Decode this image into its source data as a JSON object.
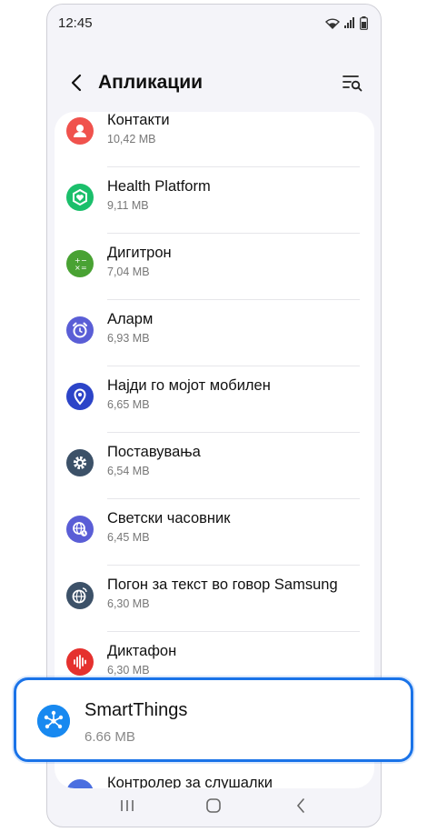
{
  "status": {
    "time": "12:45"
  },
  "header": {
    "title": "Апликации"
  },
  "apps": [
    {
      "name": "Контакти",
      "size": "10,42 MB",
      "icon": "contacts-icon",
      "color": "#f0524d"
    },
    {
      "name": "Health Platform",
      "size": "9,11 MB",
      "icon": "health-platform-icon",
      "color": "#1bbf6b"
    },
    {
      "name": "Дигитрон",
      "size": "7,04 MB",
      "icon": "calculator-icon",
      "color": "#49a233"
    },
    {
      "name": "Аларм",
      "size": "6,93 MB",
      "icon": "alarm-icon",
      "color": "#5a5ed6"
    },
    {
      "name": "Најди го мојот мобилен",
      "size": "6,65 MB",
      "icon": "find-my-mobile-icon",
      "color": "#2c44c8"
    },
    {
      "name": "Поставувања",
      "size": "6,54 MB",
      "icon": "settings-gear-icon",
      "color": "#3c5168"
    },
    {
      "name": "Светски часовник",
      "size": "6,45 MB",
      "icon": "world-clock-icon",
      "color": "#5a5ed6"
    },
    {
      "name": "Погон за текст во говор Samsung",
      "size": "6,30 MB",
      "icon": "text-to-speech-icon",
      "color": "#3c5168"
    },
    {
      "name": "Диктафон",
      "size": "6,30 MB",
      "icon": "voice-recorder-icon",
      "color": "#e5312e"
    },
    {
      "name": "Контролер за слушалки",
      "size": "",
      "icon": "earphone-controller-icon",
      "color": "#4b6fe0"
    }
  ],
  "highlight": {
    "name": "SmartThings",
    "size": "6.66 MB",
    "icon": "smartthings-icon",
    "color": "#1889f0",
    "border_color": "#1a73e8"
  }
}
